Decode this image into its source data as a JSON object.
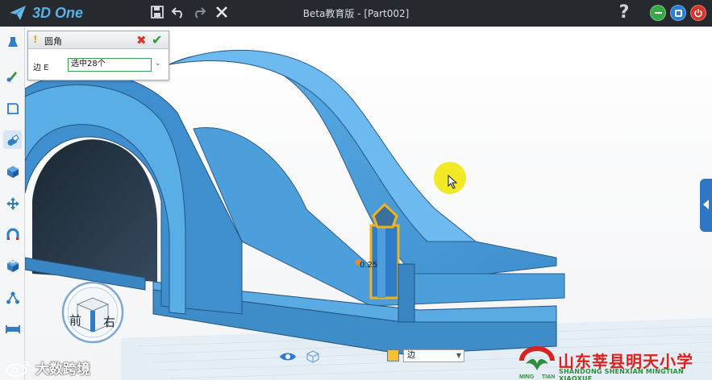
{
  "app": {
    "logo_text": "3D One",
    "window_title": "Beta教育版 - [Part002]",
    "help_label": "?"
  },
  "toolbar": {
    "icons": [
      "save-icon",
      "undo-icon",
      "redo-icon",
      "close-icon"
    ]
  },
  "window_controls": {
    "minimize_color": "#36a846",
    "restore_color": "#2a7fd4",
    "close_color": "#d6332a"
  },
  "left_toolbar": {
    "tools": [
      "primitive-shape-icon",
      "sketch-icon",
      "sketch-edit-icon",
      "feature-icon",
      "special-function-icon",
      "basic-edit-icon",
      "combine-icon",
      "measure-icon",
      "array-icon",
      "distance-icon"
    ],
    "active_index": 3
  },
  "fillet_panel": {
    "title": "圆角",
    "edge_label": "边 E",
    "edge_value": "选中28个"
  },
  "viewport": {
    "dimension_value": "0.25",
    "model_color": "#4a9fd8"
  },
  "view_cube": {
    "front_label": "前",
    "right_label": "右"
  },
  "status_bar": {
    "filter_value": "边"
  },
  "watermark": {
    "left_text": "大数跨境",
    "school_name": "山东莘县明天小学",
    "school_name_en": "SHANDONG SHENXIAN MINGTIAN XIAOXUE",
    "logo_caption_left": "MING",
    "logo_caption_right": "TIAN"
  }
}
